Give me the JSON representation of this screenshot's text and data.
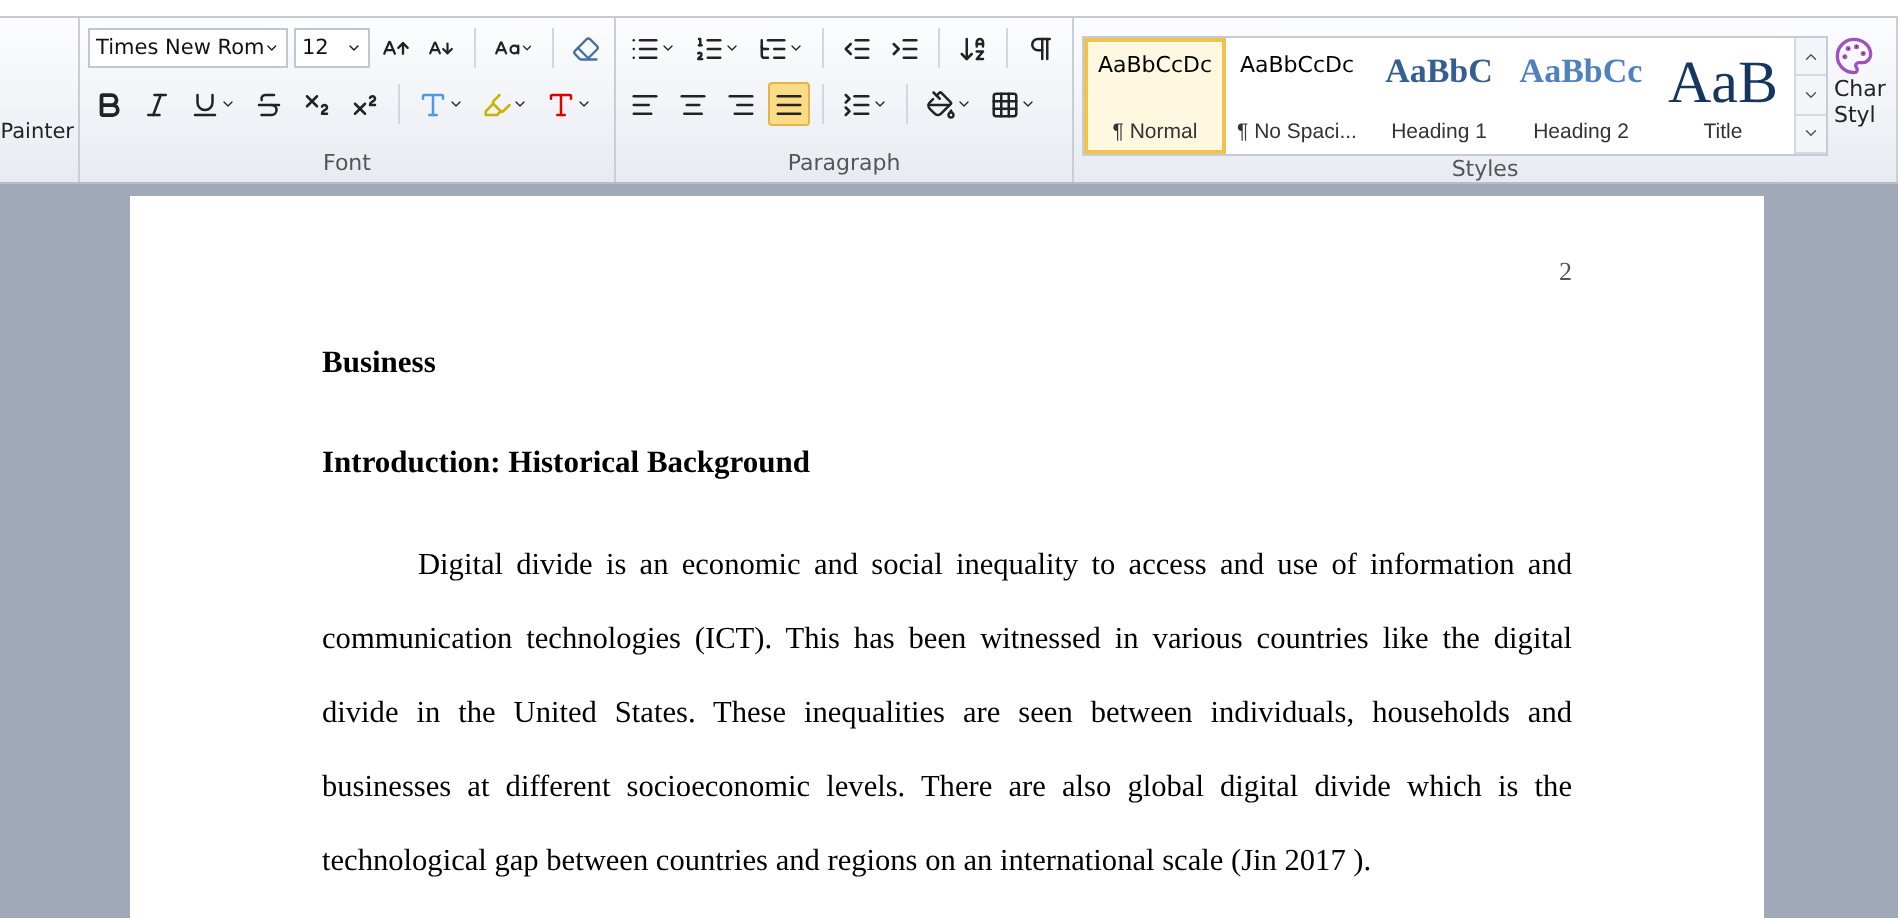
{
  "clipboard": {
    "partial_label": "Painter"
  },
  "font_group": {
    "label": "Font",
    "font_name": "Times New Rom",
    "font_size": "12"
  },
  "paragraph_group": {
    "label": "Paragraph",
    "alignments": [
      {
        "kind": "left",
        "selected": false
      },
      {
        "kind": "center",
        "selected": false
      },
      {
        "kind": "right",
        "selected": false
      },
      {
        "kind": "justify",
        "selected": true
      }
    ]
  },
  "styles_group": {
    "label": "Styles",
    "styles": [
      {
        "preview": "AaBbCcDc",
        "name": "¶ Normal",
        "kind": "normal",
        "selected": true
      },
      {
        "preview": "AaBbCcDc",
        "name": "¶ No Spaci...",
        "kind": "normal",
        "selected": false
      },
      {
        "preview": "AaBbC",
        "name": "Heading 1",
        "kind": "heading1",
        "selected": false
      },
      {
        "preview": "AaBbCc",
        "name": "Heading 2",
        "kind": "heading2",
        "selected": false
      },
      {
        "preview": "AaB",
        "name": "Title",
        "kind": "title",
        "selected": false
      }
    ],
    "change_styles": [
      "Char",
      "Styl"
    ]
  },
  "document": {
    "page_number": "2",
    "blocks": [
      {
        "kind": "heading",
        "text": "Business"
      },
      {
        "kind": "heading",
        "text": "Introduction: Historical Background"
      },
      {
        "kind": "paragraph",
        "lines": [
          "Digital divide is an economic and social inequality to access and use of information and",
          "communication technologies (ICT). This has been witnessed in various countries like the digital",
          "divide in the United States. These inequalities are seen between individuals, households and",
          "businesses at different socioeconomic levels. There are also global digital divide which is the",
          "technological gap between countries and regions on an international scale (Jin 2017 )."
        ]
      }
    ]
  }
}
